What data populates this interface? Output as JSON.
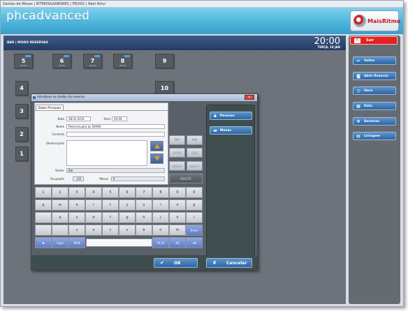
{
  "window": {
    "title": "Gestão de Mesas | RITMOS&SABORES | FB/002 | Abel Artur"
  },
  "header": {
    "logo": "phcadvanced",
    "brand": "MaisRitmo"
  },
  "topbar": {
    "label": "BAR | MODO RESERVAS",
    "time": "20:00",
    "date": "TERÇA, 18 JAN"
  },
  "tables": [
    {
      "label": "5",
      "time": "20:00"
    },
    {
      "label": "6",
      "time": "20:00"
    },
    {
      "label": "7",
      "time": "20:00"
    },
    {
      "label": "8",
      "time": "20:00"
    },
    {
      "label": "9",
      "time": ""
    },
    {
      "label": "4",
      "time": ""
    },
    {
      "label": "10",
      "time": ""
    },
    {
      "label": "3",
      "time": ""
    },
    {
      "label": "2",
      "time": ""
    },
    {
      "label": "1",
      "time": ""
    }
  ],
  "sidebar": {
    "exit": "Sair",
    "items": [
      {
        "label": "Voltar",
        "icon": "back-arrow-icon",
        "glyph": "↩"
      },
      {
        "label": "Abrir Reserva",
        "icon": "lock-icon",
        "glyph": "◙"
      },
      {
        "label": "Hora",
        "icon": "clock-icon",
        "glyph": "◷"
      },
      {
        "label": "Data",
        "icon": "calendar-icon",
        "glyph": "▦"
      },
      {
        "label": "Sectores",
        "icon": "sectors-icon",
        "glyph": "✥"
      },
      {
        "label": "Listagem",
        "icon": "list-icon",
        "glyph": "▤"
      }
    ]
  },
  "dialog": {
    "title": "Introduza os dados da reserva",
    "tab": "Dados Principais",
    "fields": {
      "data_label": "Data",
      "data_value": "18.01.2011",
      "hora_label": "Hora",
      "hora_value": "20:00",
      "nome_label": "Nome",
      "nome_value": "Reserva para as 20H00",
      "contacto_label": "Contacto",
      "contacto_value": "",
      "obs_label": "Observações",
      "obs_value": "",
      "sector_label": "Sector",
      "sector_value": "Bar",
      "ocupacao_label": "Ocupação",
      "ocupacao_value": "1/2",
      "mesas_label": "Mesas",
      "mesas_value": "9"
    },
    "nav": {
      "left": "⇦",
      "right": "⇨",
      "home": "HOME",
      "end": "END",
      "insert": "INSERT",
      "select": "SELECT",
      "delete": "DELETE"
    },
    "right_buttons": [
      {
        "label": "Pessoas",
        "icon": "people-icon",
        "glyph": "♟"
      },
      {
        "label": "Mesas",
        "icon": "table-icon",
        "glyph": "▬"
      }
    ],
    "keyboard": {
      "row1": [
        "1",
        "2",
        "3",
        "4",
        "5",
        "6",
        "7",
        "8",
        "9",
        "0"
      ],
      "row2": [
        "q",
        "w",
        "e",
        "r",
        "t",
        "y",
        "u",
        "i",
        "o",
        "p"
      ],
      "row3": [
        "",
        "a",
        "s",
        "d",
        "f",
        "g",
        "h",
        "j",
        "k",
        "l"
      ],
      "row4": [
        "",
        "",
        "z",
        "x",
        "c",
        "v",
        "b",
        "n",
        "m",
        "Enter"
      ],
      "row5": {
        "caps": "Caps",
        "shift": "Shift",
        "altgr": "Alt Gr",
        "alt": "Alt",
        "back": "⌫"
      }
    },
    "ok": "OK",
    "cancel": "Cancelar"
  }
}
